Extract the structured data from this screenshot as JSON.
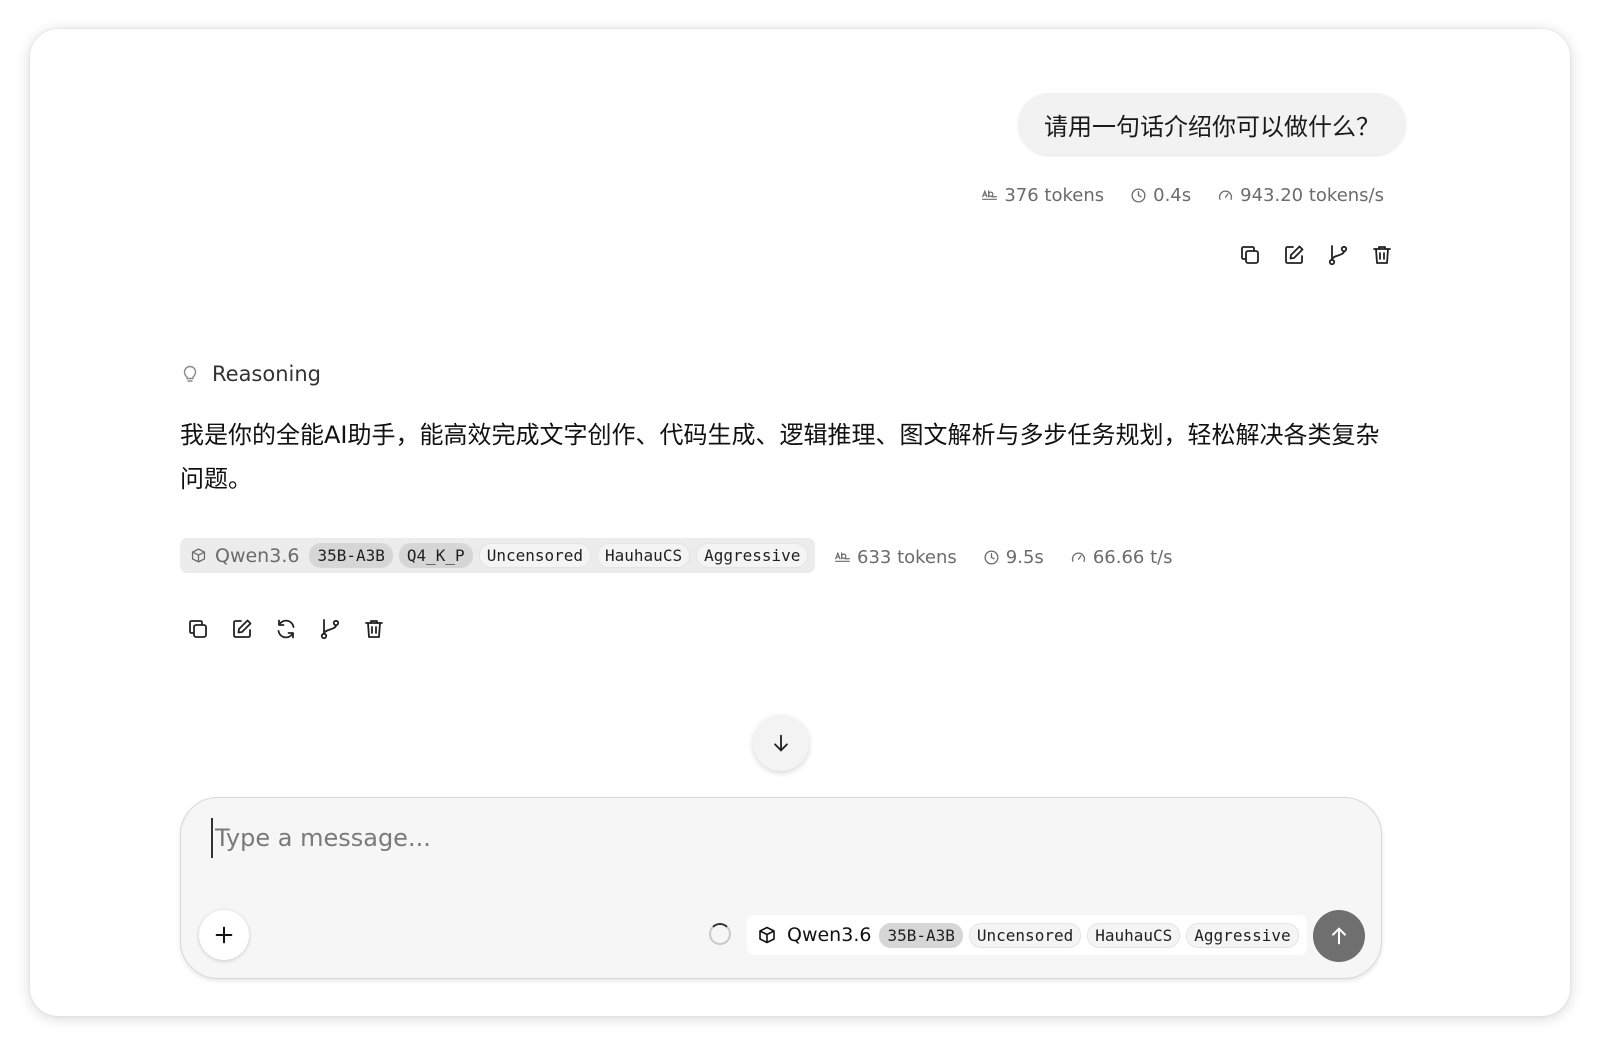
{
  "user_message": {
    "text": "请用一句话介绍你可以做什么？",
    "stats": {
      "tokens": "376 tokens",
      "time": "0.4s",
      "speed": "943.20 tokens/s"
    }
  },
  "assistant_message": {
    "reasoning_label": "Reasoning",
    "text": "我是你的全能AI助手，能高效完成文字创作、代码生成、逻辑推理、图文解析与多步任务规划，轻松解决各类复杂问题。",
    "model": {
      "name": "Qwen3.6",
      "tags": [
        "35B-A3B",
        "Q4_K_P",
        "Uncensored",
        "HauhauCS",
        "Aggressive"
      ]
    },
    "stats": {
      "tokens": "633 tokens",
      "time": "9.5s",
      "speed": "66.66 t/s"
    }
  },
  "composer": {
    "placeholder": "Type a message...",
    "value": "",
    "model": {
      "name": "Qwen3.6",
      "tags": [
        "35B-A3B",
        "Uncensored",
        "HauhauCS",
        "Aggressive"
      ]
    }
  },
  "icons": {
    "tokens": "text-ab-icon",
    "time": "clock-icon",
    "speed": "gauge-icon",
    "copy": "copy-icon",
    "edit": "edit-icon",
    "branch": "git-branch-icon",
    "delete": "trash-icon",
    "regenerate": "refresh-icon",
    "reasoning": "lightbulb-icon",
    "model": "cube-icon",
    "scroll": "arrow-down-icon",
    "attach": "plus-icon",
    "send": "arrow-up-icon"
  },
  "colors": {
    "send_button": "#6f6f6f",
    "bubble": "#f2f2f2",
    "chip": "#ececec"
  }
}
